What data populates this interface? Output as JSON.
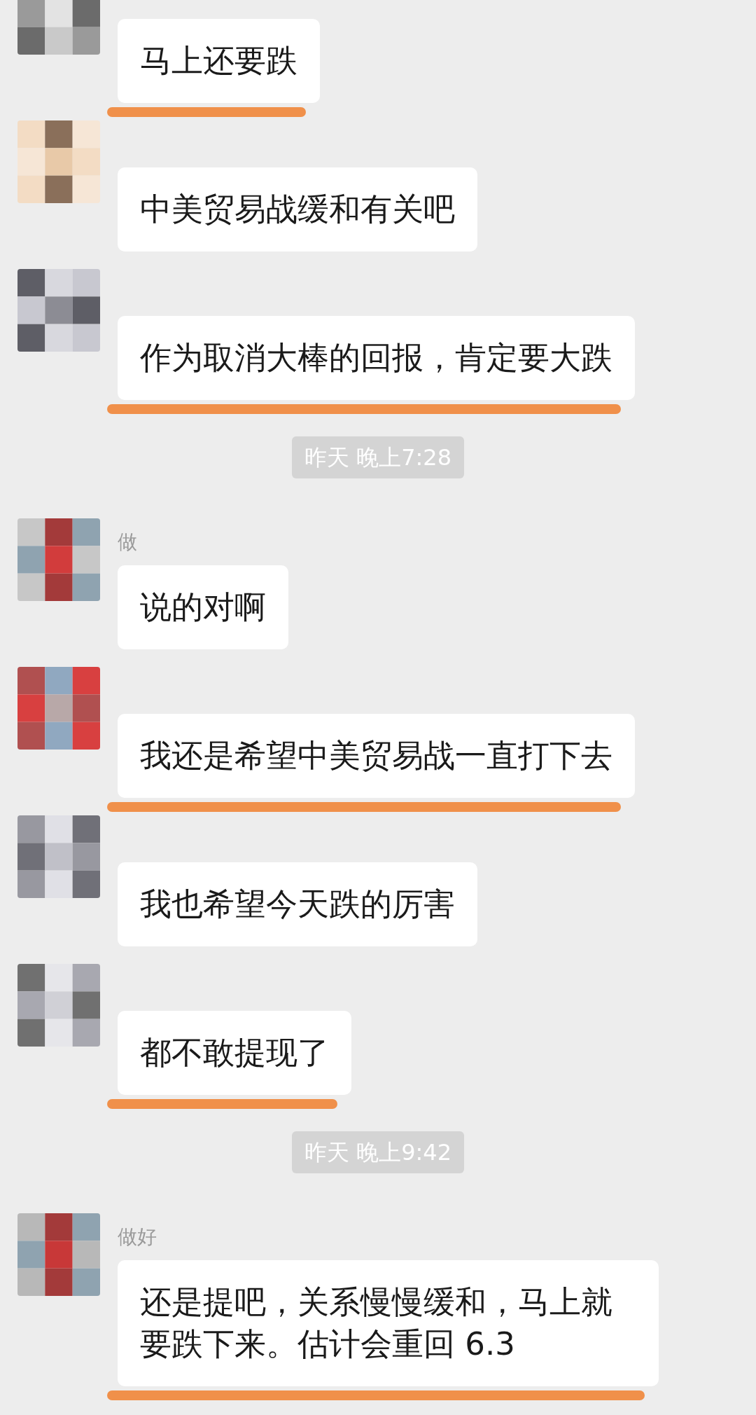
{
  "messages": [
    {
      "kind": "message",
      "text": "马上还要跌",
      "underlined": true
    },
    {
      "kind": "message",
      "text": "中美贸易战缓和有关吧",
      "underlined": false
    },
    {
      "kind": "message",
      "text": "作为取消大棒的回报，肯定要大跌",
      "underlined": true
    },
    {
      "kind": "time",
      "text": "昨天 晚上7:28"
    },
    {
      "kind": "message",
      "name": "做",
      "text": "说的对啊",
      "underlined": false
    },
    {
      "kind": "message",
      "text": "我还是希望中美贸易战一直打下去",
      "underlined": true
    },
    {
      "kind": "message",
      "text": "我也希望今天跌的厉害",
      "underlined": false
    },
    {
      "kind": "message",
      "text": "都不敢提现了",
      "underlined": true
    },
    {
      "kind": "time",
      "text": "昨天 晚上9:42"
    },
    {
      "kind": "message",
      "name": "做好",
      "text": "还是提吧，关系慢慢缓和，马上就要跌下来。估计会重回 6.3",
      "underlined": true
    }
  ]
}
